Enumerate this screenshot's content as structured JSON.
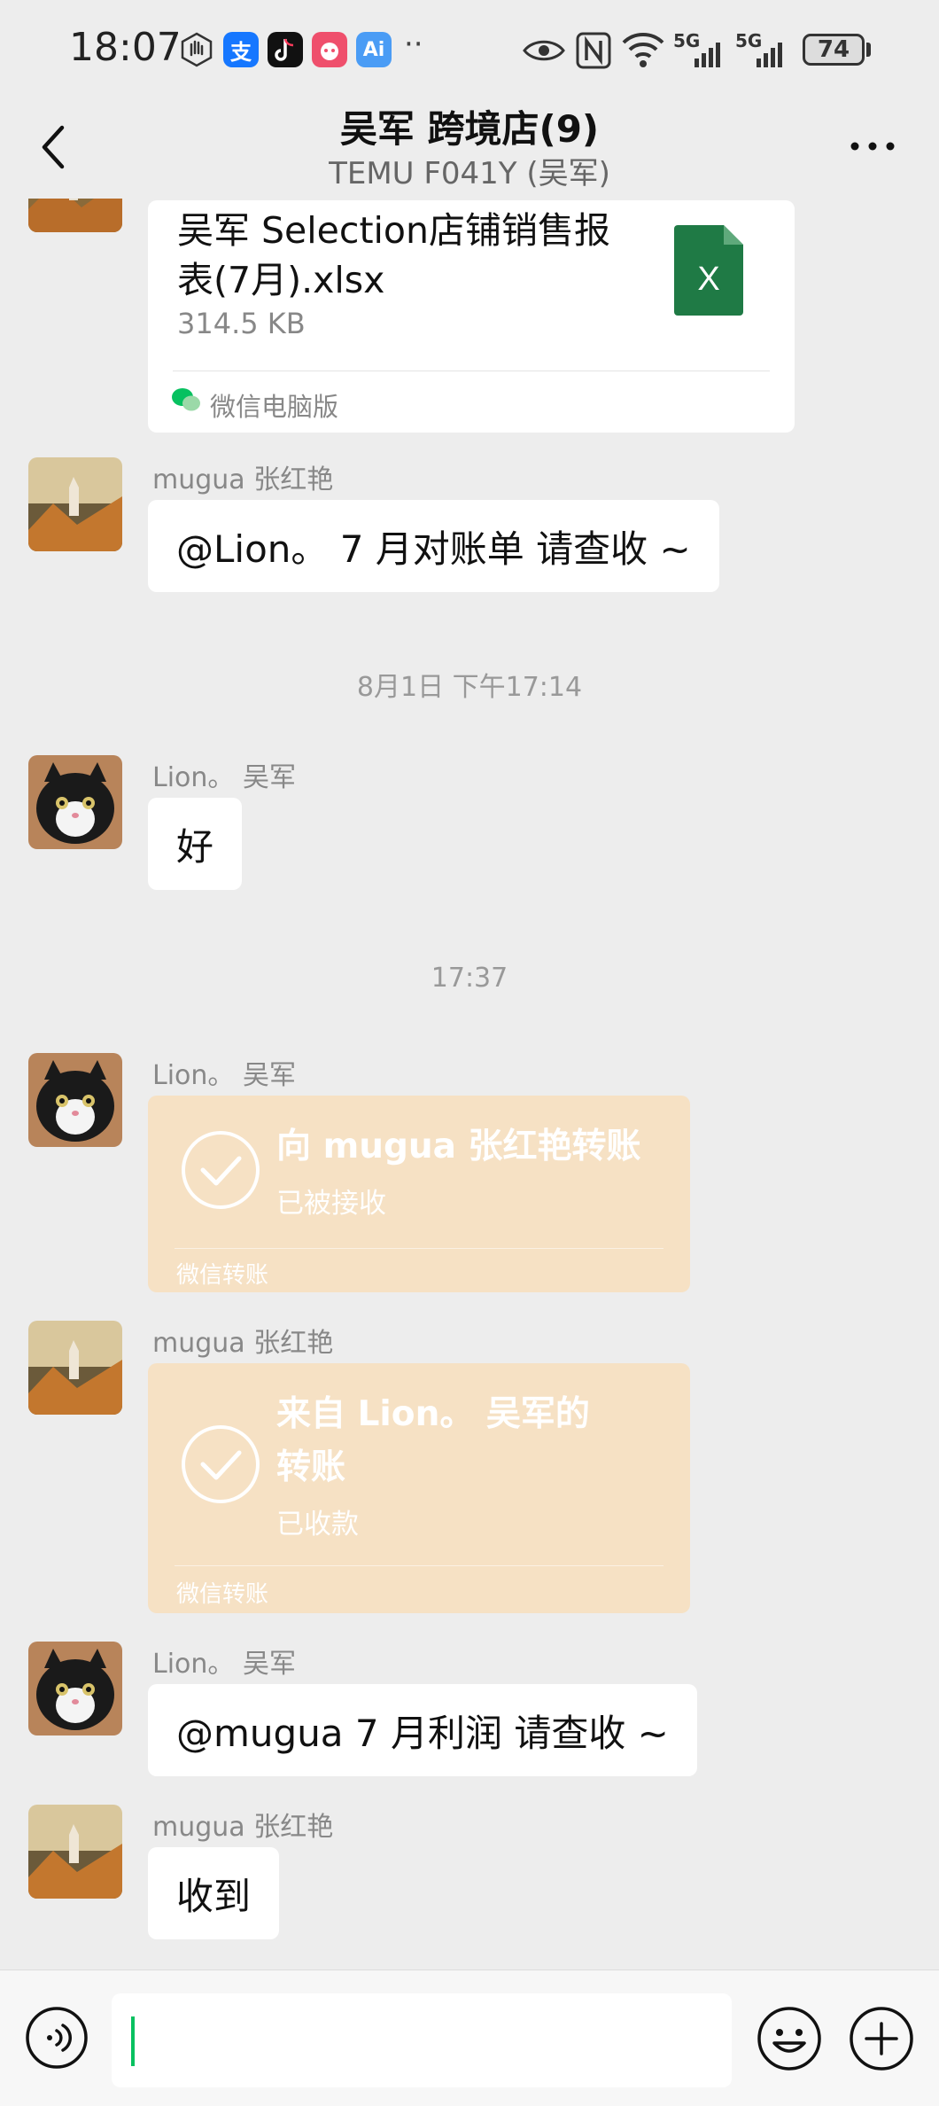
{
  "status_bar": {
    "time": "18:07",
    "apps": [
      {
        "icon": "hand-icon",
        "label": ""
      },
      {
        "icon": "alipay-icon",
        "label": "支"
      },
      {
        "icon": "tiktok-icon",
        "label": ""
      },
      {
        "icon": "app-3615-icon",
        "label": ""
      },
      {
        "icon": "ai-icon",
        "label": "Ai"
      }
    ],
    "more_dots": "··",
    "network_1": "5G",
    "network_2": "5G",
    "battery": "74",
    "colors": {
      "alipay": "#1677ff",
      "tiktok": "#111111",
      "ai": "#4a9cf5",
      "app3615": "#ef4f6c"
    }
  },
  "header": {
    "title": "吴军  跨境店(9)",
    "subtitle": "TEMU F041Y (吴军)"
  },
  "messages": {
    "file": {
      "name": "吴军 Selection店铺销售报表(7月).xlsx",
      "size": "314.5 KB",
      "source": "微信电脑版",
      "icon_letter": "X"
    },
    "m1": {
      "sender": "mugua 张红艳",
      "text": "@Lion。 7 月对账单 请查收 ~"
    },
    "ts1": "8月1日 下午17:14",
    "m2": {
      "sender": "Lion。 吴军",
      "text": "好"
    },
    "ts2": "17:37",
    "m3": {
      "sender": "Lion。 吴军",
      "title": "向 mugua 张红艳转账",
      "status": "已被接收",
      "footer": "微信转账"
    },
    "m4": {
      "sender": "mugua 张红艳",
      "title_line1": "来自 Lion。 吴军的",
      "title_line2": "转账",
      "status": "已收款",
      "footer": "微信转账"
    },
    "m5": {
      "sender": "Lion。 吴军",
      "text": "@mugua 7 月利润 请查收 ~"
    },
    "m6": {
      "sender": "mugua 张红艳",
      "text": "收到"
    }
  },
  "input_bar": {
    "placeholder": "",
    "value": ""
  },
  "colors": {
    "background": "#ededed",
    "bubble": "#ffffff",
    "transfer_card": "#f6e1c4",
    "excel_green": "#1f7a45",
    "caret_green": "#07c160"
  }
}
